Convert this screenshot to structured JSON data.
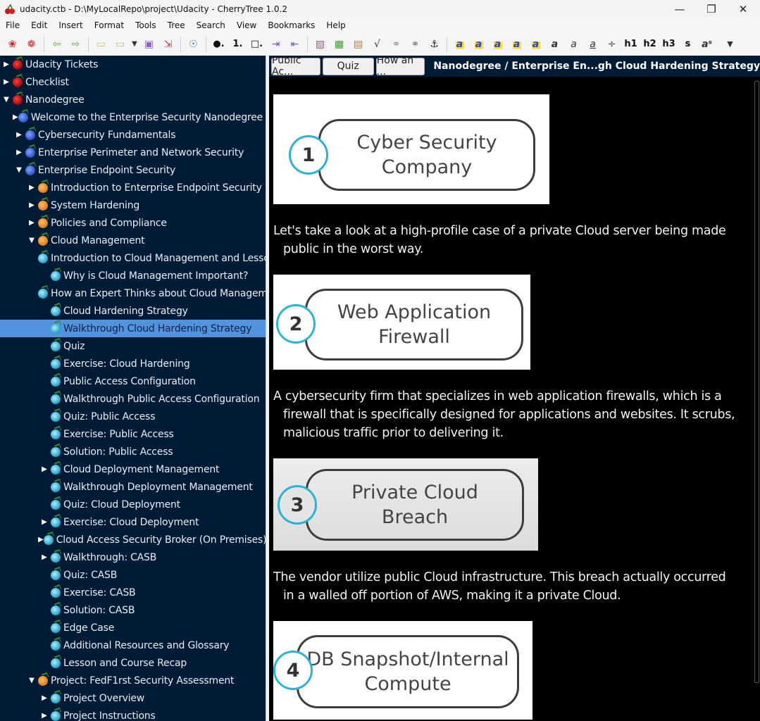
{
  "window": {
    "title": "udacity.ctb - D:\\MyLocalRepo\\project\\Udacity - CherryTree 1.0.2",
    "controls": {
      "minimize": "—",
      "maximize": "❐",
      "close": "✕"
    }
  },
  "menu": [
    "File",
    "Edit",
    "Insert",
    "Format",
    "Tools",
    "Tree",
    "Search",
    "View",
    "Bookmarks",
    "Help"
  ],
  "toolbar": {
    "items": [
      {
        "name": "add-node-icon",
        "glyph": "❀"
      },
      {
        "name": "add-subnode-icon",
        "glyph": "❁"
      },
      {
        "sep": true
      },
      {
        "name": "go-back-icon",
        "glyph": "⇦"
      },
      {
        "name": "go-forward-icon",
        "glyph": "⇨"
      },
      {
        "sep": true
      },
      {
        "name": "open-folder-icon",
        "glyph": "▭"
      },
      {
        "name": "open-recent-icon",
        "glyph": "▭"
      },
      {
        "name": "dropdown-arrow-icon",
        "glyph": "▼"
      },
      {
        "name": "save-icon",
        "glyph": "▣"
      },
      {
        "name": "export-icon",
        "glyph": "⇲"
      },
      {
        "sep": true
      },
      {
        "name": "find-node-icon",
        "glyph": "☉"
      },
      {
        "sep": true
      },
      {
        "name": "bulleted-list-icon",
        "glyph": "●."
      },
      {
        "name": "numbered-list-icon",
        "glyph": "1."
      },
      {
        "name": "todo-list-icon",
        "glyph": "□."
      },
      {
        "name": "indent-icon",
        "glyph": "⇥"
      },
      {
        "name": "unindent-icon",
        "glyph": "⇤"
      },
      {
        "sep": true
      },
      {
        "name": "insert-image-icon",
        "glyph": "▨"
      },
      {
        "name": "insert-table-icon",
        "glyph": "▦"
      },
      {
        "name": "insert-codebox-icon",
        "glyph": "▤"
      },
      {
        "name": "insert-latex-icon",
        "glyph": "√"
      },
      {
        "name": "insert-link-icon",
        "glyph": "⚭"
      },
      {
        "name": "insert-link-alt-icon",
        "glyph": "⚭"
      },
      {
        "name": "insert-anchor-icon",
        "glyph": "⚓"
      },
      {
        "sep": true
      },
      {
        "name": "text-color-icon",
        "glyph": "a"
      },
      {
        "name": "background-color-icon",
        "glyph": "a"
      },
      {
        "name": "remove-format-icon",
        "glyph": "a"
      },
      {
        "name": "highlight-fg-icon",
        "glyph": "a"
      },
      {
        "name": "highlight-bg-icon",
        "glyph": "a"
      },
      {
        "name": "bold-icon",
        "glyph": "a"
      },
      {
        "name": "italic-icon",
        "glyph": "a"
      },
      {
        "name": "underline-icon",
        "glyph": "a"
      },
      {
        "name": "strikethrough-icon",
        "glyph": "÷"
      },
      {
        "name": "heading1-button",
        "glyph": "h1"
      },
      {
        "name": "heading2-button",
        "glyph": "h2"
      },
      {
        "name": "heading3-button",
        "glyph": "h3"
      },
      {
        "name": "small-text-button",
        "glyph": "s"
      },
      {
        "name": "superscript-icon",
        "glyph": "aˢ"
      },
      {
        "name": "more-dropdown-icon",
        "glyph": "▼"
      }
    ]
  },
  "tree": [
    {
      "label": "Udacity Tickets",
      "level": 0,
      "exp": "collapsed",
      "color": "red"
    },
    {
      "label": "Checklist",
      "level": 0,
      "exp": "collapsed",
      "color": "red"
    },
    {
      "label": "Nanodegree",
      "level": 0,
      "exp": "expanded",
      "color": "red"
    },
    {
      "label": "Welcome to the Enterprise Security Nanodegree Program",
      "level": 1,
      "exp": "collapsed",
      "color": "blue"
    },
    {
      "label": "Cybersecurity Fundamentals",
      "level": 1,
      "exp": "collapsed",
      "color": "blue"
    },
    {
      "label": "Enterprise Perimeter and Network Security",
      "level": 1,
      "exp": "collapsed",
      "color": "blue"
    },
    {
      "label": "Enterprise Endpoint Security",
      "level": 1,
      "exp": "expanded",
      "color": "blue"
    },
    {
      "label": "Introduction to Enterprise Endpoint Security",
      "level": 2,
      "exp": "collapsed",
      "color": "orange"
    },
    {
      "label": "System Hardening",
      "level": 2,
      "exp": "collapsed",
      "color": "orange"
    },
    {
      "label": "Policies and Compliance",
      "level": 2,
      "exp": "collapsed",
      "color": "orange"
    },
    {
      "label": "Cloud Management",
      "level": 2,
      "exp": "expanded",
      "color": "orange"
    },
    {
      "label": "Introduction to Cloud Management and Lesson Overview",
      "level": 3,
      "exp": "none",
      "color": "cyan"
    },
    {
      "label": "Why is Cloud Management Important?",
      "level": 3,
      "exp": "none",
      "color": "cyan"
    },
    {
      "label": "How an Expert Thinks about Cloud Management",
      "level": 3,
      "exp": "none",
      "color": "cyan"
    },
    {
      "label": "Cloud Hardening Strategy",
      "level": 3,
      "exp": "none",
      "color": "cyan"
    },
    {
      "label": "Walkthrough Cloud Hardening Strategy",
      "level": 3,
      "exp": "none",
      "color": "cyan",
      "selected": true
    },
    {
      "label": "Quiz",
      "level": 3,
      "exp": "none",
      "color": "cyan"
    },
    {
      "label": "Exercise: Cloud Hardening",
      "level": 3,
      "exp": "none",
      "color": "cyan"
    },
    {
      "label": "Public Access Configuration",
      "level": 3,
      "exp": "none",
      "color": "cyan"
    },
    {
      "label": "Walkthrough Public Access Configuration",
      "level": 3,
      "exp": "none",
      "color": "cyan"
    },
    {
      "label": "Quiz: Public Access",
      "level": 3,
      "exp": "none",
      "color": "cyan"
    },
    {
      "label": "Exercise: Public Access",
      "level": 3,
      "exp": "none",
      "color": "cyan"
    },
    {
      "label": "Solution: Public Access",
      "level": 3,
      "exp": "none",
      "color": "cyan"
    },
    {
      "label": "Cloud Deployment Management",
      "level": 3,
      "exp": "collapsed",
      "color": "cyan"
    },
    {
      "label": "Walkthrough Deployment Management",
      "level": 3,
      "exp": "none",
      "color": "cyan"
    },
    {
      "label": "Quiz: Cloud Deployment",
      "level": 3,
      "exp": "none",
      "color": "cyan"
    },
    {
      "label": "Exercise: Cloud Deployment",
      "level": 3,
      "exp": "collapsed",
      "color": "cyan"
    },
    {
      "label": "Cloud Access Security Broker (On Premises)",
      "level": 3,
      "exp": "collapsed",
      "color": "cyan"
    },
    {
      "label": "Walkthrough: CASB",
      "level": 3,
      "exp": "collapsed",
      "color": "cyan"
    },
    {
      "label": "Quiz: CASB",
      "level": 3,
      "exp": "none",
      "color": "cyan"
    },
    {
      "label": "Exercise: CASB",
      "level": 3,
      "exp": "none",
      "color": "cyan"
    },
    {
      "label": "Solution: CASB",
      "level": 3,
      "exp": "none",
      "color": "cyan"
    },
    {
      "label": "Edge Case",
      "level": 3,
      "exp": "none",
      "color": "cyan"
    },
    {
      "label": "Additional Resources and Glossary",
      "level": 3,
      "exp": "none",
      "color": "cyan"
    },
    {
      "label": "Lesson and Course Recap",
      "level": 3,
      "exp": "none",
      "color": "cyan"
    },
    {
      "label": "Project: FedF1rst Security Assessment",
      "level": 2,
      "exp": "expanded",
      "color": "orange"
    },
    {
      "label": "Project Overview",
      "level": 3,
      "exp": "collapsed",
      "color": "cyan"
    },
    {
      "label": "Project Instructions",
      "level": 3,
      "exp": "collapsed",
      "color": "cyan"
    }
  ],
  "tabs": [
    {
      "label": "Public Ac..."
    },
    {
      "label": "Quiz"
    },
    {
      "label": "How an ..."
    }
  ],
  "breadcrumb": "Nanodegree / Enterprise En...gh Cloud Hardening Strategy",
  "content": {
    "images": [
      {
        "number": "1",
        "line1": "Cyber Security",
        "line2": "Company"
      },
      {
        "number": "2",
        "line1": "Web Application",
        "line2": "Firewall"
      },
      {
        "number": "3",
        "line1": "Private Cloud",
        "line2": "Breach"
      },
      {
        "number": "4",
        "line1": "DB Snapshot/Internal",
        "line2": "Compute"
      }
    ],
    "paragraphs": [
      {
        "first": "Let's take a look at a high-profile case of a private Cloud server being made",
        "rest": [
          "public in the worst way."
        ]
      },
      {
        "first": "A cybersecurity firm that specializes in web application firewalls, which is a",
        "rest": [
          "firewall that is specifically designed for applications and websites. It scrubs,",
          "malicious traffic prior to delivering it."
        ]
      },
      {
        "first": "The vendor utilize public Cloud infrastructure. This breach actually occurred",
        "rest": [
          "in a walled off portion of AWS, making it a private Cloud."
        ]
      }
    ]
  },
  "colors": {
    "tree_bg": "#001b35",
    "selected_row": "#5293e0",
    "editor_bg": "#000000",
    "editor_text": "#f2f2f2",
    "number_ring": "#2bb3d3"
  }
}
